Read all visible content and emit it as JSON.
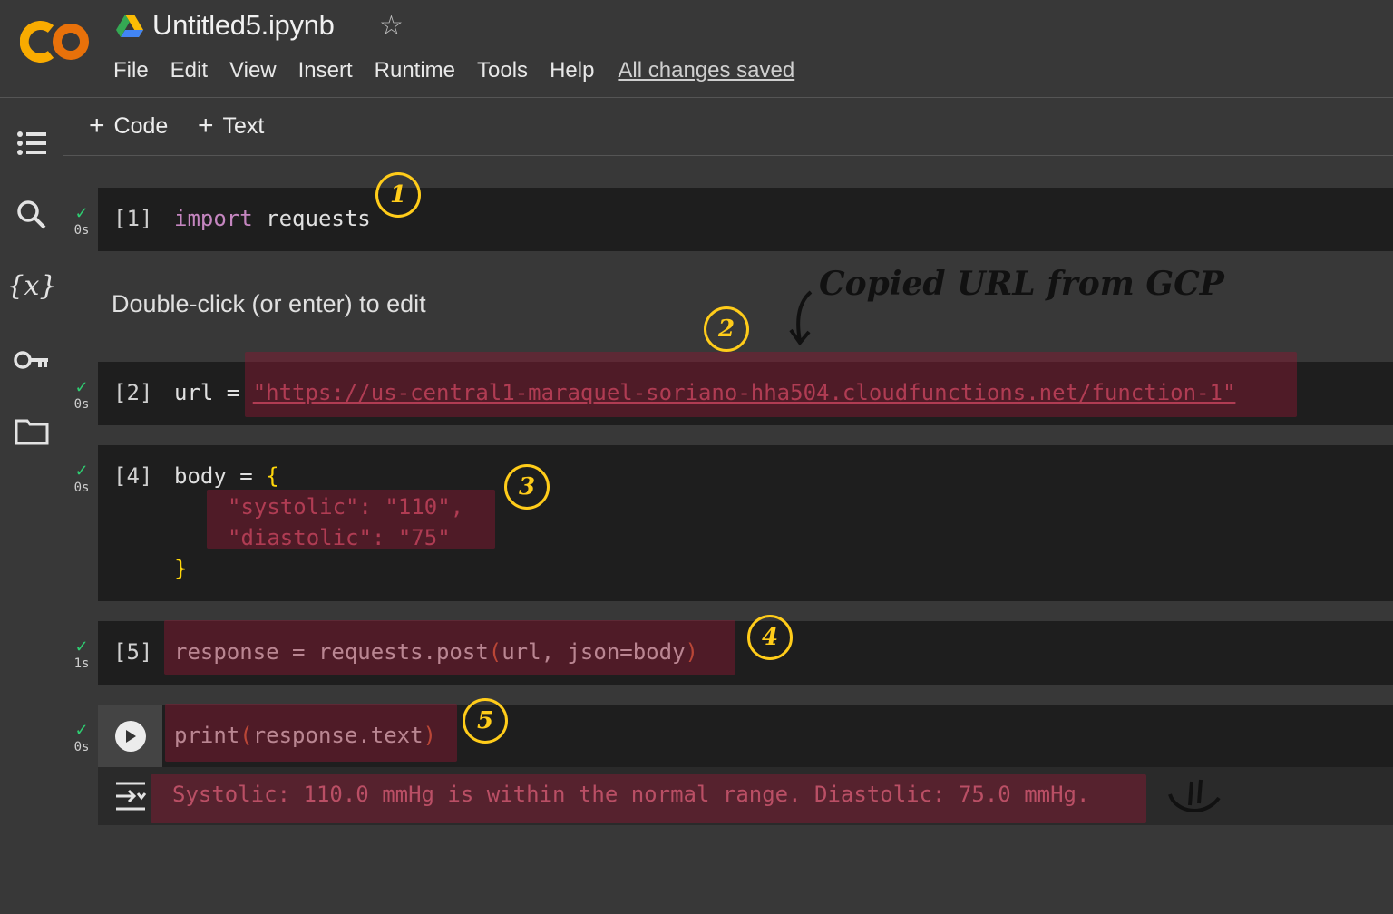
{
  "app": {
    "logo_text": "CO",
    "notebook_title": "Untitled5.ipynb"
  },
  "menu": [
    "File",
    "Edit",
    "View",
    "Insert",
    "Runtime",
    "Tools",
    "Help"
  ],
  "save_status": "All changes saved",
  "toolbar": {
    "add_code": "Code",
    "add_text": "Text"
  },
  "sidebar": {
    "items": [
      {
        "name": "table-of-contents",
        "icon": "list-icon"
      },
      {
        "name": "find",
        "icon": "search-icon"
      },
      {
        "name": "variables",
        "icon": "variables-icon",
        "label": "{x}"
      },
      {
        "name": "secrets",
        "icon": "key-icon"
      },
      {
        "name": "files",
        "icon": "folder-icon"
      }
    ]
  },
  "cells": [
    {
      "prompt": "[1]",
      "status": "0s",
      "code": {
        "kw": "import",
        "rest": " requests"
      }
    },
    {
      "type": "text",
      "content": "Double-click (or enter) to edit"
    },
    {
      "prompt": "[2]",
      "status": "0s",
      "code": {
        "lhs": "url = ",
        "value": "\"https://us-central1-maraquel-soriano-hha504.cloudfunctions.net/function-1\""
      }
    },
    {
      "prompt": "[4]",
      "status": "0s",
      "code": {
        "line1": "body = ",
        "open": "{",
        "line2": "\"systolic\": \"110\",",
        "line3": "\"diastolic\": \"75\"",
        "close": "}"
      }
    },
    {
      "prompt": "[5]",
      "status": "1s",
      "code": {
        "a": "response = requests.post",
        "open": "(",
        "b": "url, json=body",
        "close": ")"
      }
    },
    {
      "status": "0s",
      "code": {
        "a": "print",
        "open": "(",
        "b": "response.text",
        "close": ")"
      }
    }
  ],
  "output": "Systolic: 110.0 mmHg is within the normal range. Diastolic: 75.0 mmHg.",
  "annotations": {
    "numbers": [
      "1",
      "2",
      "3",
      "4",
      "5"
    ],
    "note": "Copied URL from GCP"
  },
  "colors": {
    "background": "#383838",
    "cell_bg": "#1e1e1e",
    "string": "#ce5a6e",
    "keyword": "#c586c0",
    "annotation": "#ffcc1a",
    "check": "#2ecc71"
  }
}
